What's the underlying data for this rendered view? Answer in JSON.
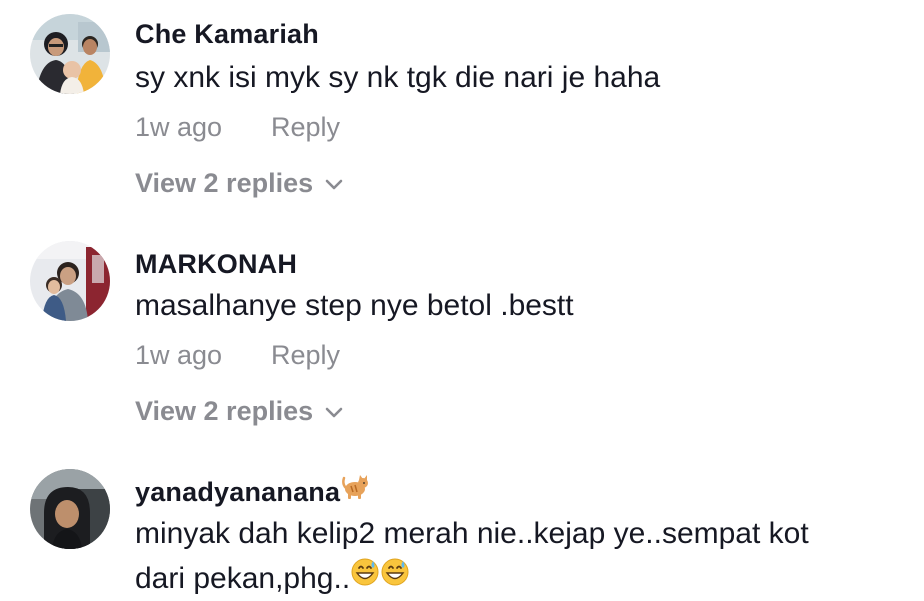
{
  "comments": [
    {
      "username": "Che Kamariah",
      "text": "sy xnk isi myk sy nk tgk die nari je haha",
      "time": "1w ago",
      "reply_label": "Reply",
      "view_replies": "View 2 replies"
    },
    {
      "username": "MARKONAH",
      "text": "masalhanye step nye betol .bestt",
      "time": "1w ago",
      "reply_label": "Reply",
      "view_replies": "View 2 replies"
    },
    {
      "username": "yanadyananana",
      "username_icon": "cat-emoji-icon",
      "text_line1": "minyak dah kelip2 merah nie..kejap ye..sempat kot",
      "text_line2": "dari pekan,phg..",
      "text_icons": [
        "grinning-sweat-emoji-icon",
        "grinning-sweat-emoji-icon"
      ]
    }
  ],
  "colors": {
    "primary_text": "#161823",
    "secondary_text": "#8a8b91",
    "background": "#ffffff"
  }
}
